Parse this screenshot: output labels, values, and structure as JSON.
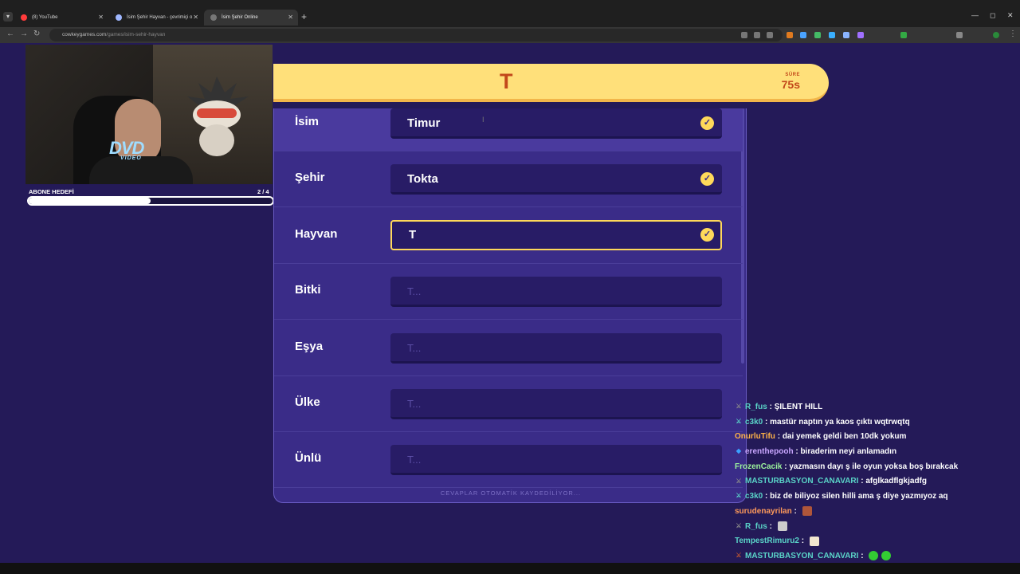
{
  "browser": {
    "tabs": [
      {
        "title": "(8) YouTube",
        "fav_color": "#ff3b3b",
        "active": false
      },
      {
        "title": "İsim Şehir Hayvan - çevrimiçi o",
        "fav_color": "#9fb7ff",
        "active": false
      },
      {
        "title": "İsim Şehir Online",
        "fav_color": "#777777",
        "active": true
      }
    ],
    "url_host": "cowkeygames.com",
    "url_path": "/games/isim-sehir-hayvan"
  },
  "stream": {
    "webcam_overlay": "DVD",
    "webcam_overlay_sub": "VIDEO",
    "sub_goal": {
      "label": "ABONE HEDEFİ",
      "count": "2  / 4",
      "progress": 0.5
    }
  },
  "game": {
    "letter": "T",
    "timer_label": "SÜRE",
    "timer_value": "75s",
    "fields": [
      {
        "label": "İsim",
        "value": "Timur",
        "placeholder": "",
        "filled": true,
        "focused": false
      },
      {
        "label": "Şehir",
        "value": "Tokta",
        "placeholder": "",
        "filled": true,
        "focused": false
      },
      {
        "label": "Hayvan",
        "value": "T",
        "placeholder": "",
        "filled": true,
        "focused": true
      },
      {
        "label": "Bitki",
        "value": "",
        "placeholder": "T...",
        "filled": false,
        "focused": false
      },
      {
        "label": "Eşya",
        "value": "",
        "placeholder": "T...",
        "filled": false,
        "focused": false
      },
      {
        "label": "Ülke",
        "value": "",
        "placeholder": "T...",
        "filled": false,
        "focused": false
      },
      {
        "label": "Ünlü",
        "value": "",
        "placeholder": "T...",
        "filled": false,
        "focused": false
      }
    ],
    "footer_note": "CEVAPLAR OTOMATİK KAYDEDİLİYOR..."
  },
  "chat": [
    {
      "user": "R_fus",
      "color": "#5ad4c8",
      "text": "ŞILENT HILL",
      "badge": "sword",
      "badge_color": "#8a8a8a",
      "emotes": []
    },
    {
      "user": "c3k0",
      "color": "#5ad4c8",
      "text": "mastür naptın ya kaos çıktı wqtrwqtq",
      "badge": "sword",
      "badge_color": "#5ad4c8",
      "emotes": []
    },
    {
      "user": "OnurluTifu",
      "color": "#ffb347",
      "text": "dai yemek geldi ben 10dk yokum",
      "badge": "",
      "badge_color": "",
      "emotes": []
    },
    {
      "user": "erenthepooh",
      "color": "#c9a6ff",
      "text": "biraderim neyi anlamadın",
      "badge": "gem",
      "badge_color": "#3aa0ff",
      "emotes": []
    },
    {
      "user": "FrozenCacik",
      "color": "#9df59d",
      "text": "yazmasın dayı ş ile oyun yoksa boş bırakcak",
      "badge": "",
      "badge_color": "",
      "emotes": []
    },
    {
      "user": "MASTURBASYON_CANAVARI",
      "color": "#5ad4c8",
      "text": "afglkadflgkjadfg",
      "badge": "sword",
      "badge_color": "#8a8a8a",
      "emotes": []
    },
    {
      "user": "c3k0",
      "color": "#5ad4c8",
      "text": "biz de biliyoz silen hilli ama ş diye yazmıyoz aq",
      "badge": "sword",
      "badge_color": "#5ad4c8",
      "emotes": []
    },
    {
      "user": "surudenayrilan",
      "color": "#ff9a5a",
      "text": "",
      "badge": "",
      "badge_color": "",
      "emotes": [
        "#b0563a"
      ]
    },
    {
      "user": "R_fus",
      "color": "#5ad4c8",
      "text": "",
      "badge": "sword",
      "badge_color": "#8a8a8a",
      "emotes": [
        "#cccccc"
      ]
    },
    {
      "user": "TempestRimuru2",
      "color": "#5ad4c8",
      "text": "",
      "badge": "",
      "badge_color": "",
      "emotes": [
        "#f2e6cf"
      ]
    },
    {
      "user": "MASTURBASYON_CANAVARI",
      "color": "#5ad4c8",
      "text": "",
      "badge": "sword",
      "badge_color": "#c0562f",
      "emotes": [
        "#33cc33",
        "#33cc33"
      ]
    }
  ]
}
